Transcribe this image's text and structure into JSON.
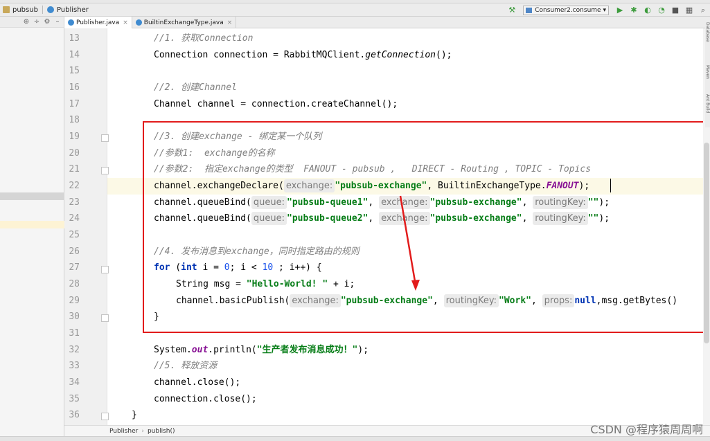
{
  "nav": {
    "project": "pubsub",
    "file": "Publisher"
  },
  "run": {
    "config": "Consumer2.consume"
  },
  "tabs": [
    {
      "label": "Publisher.java",
      "close": "×"
    },
    {
      "label": "BuiltinExchangeType.java",
      "close": "×"
    }
  ],
  "gutter": {
    "line_numbers": [
      "13",
      "14",
      "15",
      "16",
      "17",
      "18",
      "19",
      "20",
      "21",
      "22",
      "23",
      "24",
      "25",
      "26",
      "27",
      "28",
      "29",
      "30",
      "31",
      "32",
      "33",
      "34",
      "35",
      "36"
    ]
  },
  "code": {
    "l13": "//1. 获取Connection",
    "l14_a": "Connection connection = RabbitMQClient.",
    "l14_b": "getConnection",
    "l14_c": "();",
    "l16": "//2. 创建Channel",
    "l17": "Channel channel = connection.createChannel();",
    "l19": "//3. 创建exchange - 绑定某一个队列",
    "l20": "//参数1:  exchange的名称",
    "l21": "//参数2:  指定exchange的类型  FANOUT - pubsub ,   DIRECT - Routing , TOPIC - Topics",
    "l22_a": "channel.exchangeDeclare(",
    "l22_hint": "exchange:",
    "l22_str": "\"pubsub-exchange\"",
    "l22_b": ", BuiltinExchangeType.",
    "l22_static": "FANOUT",
    "l22_c": ");",
    "l23_a": "channel.queueBind(",
    "l23_hint1": "queue:",
    "l23_str1": "\"pubsub-queue1\"",
    "l23_hint2": "exchange:",
    "l23_str2": "\"pubsub-exchange\"",
    "l23_hint3": "routingKey:",
    "l23_str3": "\"\"",
    "l23_end": ");",
    "l24_a": "channel.queueBind(",
    "l24_hint1": "queue:",
    "l24_str1": "\"pubsub-queue2\"",
    "l24_hint2": "exchange:",
    "l24_str2": "\"pubsub-exchange\"",
    "l24_hint3": "routingKey:",
    "l24_str3": "\"\"",
    "l24_end": ");",
    "l26": "//4. 发布消息到exchange，同时指定路由的规则",
    "l27_kw1": "for",
    "l27_a": " (",
    "l27_kw2": "int",
    "l27_b": " i = ",
    "l27_n1": "0",
    "l27_c": "; i < ",
    "l27_n2": "10",
    "l27_d": " ; i++) {",
    "l28_a": "String msg = ",
    "l28_str": "\"Hello-World! \"",
    "l28_b": " + i;",
    "l29_a": "channel.basicPublish(",
    "l29_hint1": "exchange:",
    "l29_str1": "\"pubsub-exchange\"",
    "l29_hint2": "routingKey:",
    "l29_str2": "\"Work\"",
    "l29_hint3": "props:",
    "l29_kw": "null",
    "l29_b": ",msg.getBytes()",
    "l30": "}",
    "l32_a": "System.",
    "l32_static": "out",
    "l32_b": ".println(",
    "l32_str": "\"生产者发布消息成功！\"",
    "l32_c": ");",
    "l33": "//5. 释放资源",
    "l34": "channel.close();",
    "l35": "connection.close();",
    "l36": "}"
  },
  "breadcrumb": {
    "items": [
      "Publisher",
      "publish()"
    ],
    "separator": "›"
  },
  "right_strip": {
    "labels": [
      "Database",
      "Maven",
      "Ant Build"
    ]
  },
  "watermark": "CSDN @程序猿周周啊",
  "colors": {
    "annotation": "#e21b1b",
    "string": "#067d17",
    "keyword": "#0033b3",
    "comment": "#808080"
  }
}
